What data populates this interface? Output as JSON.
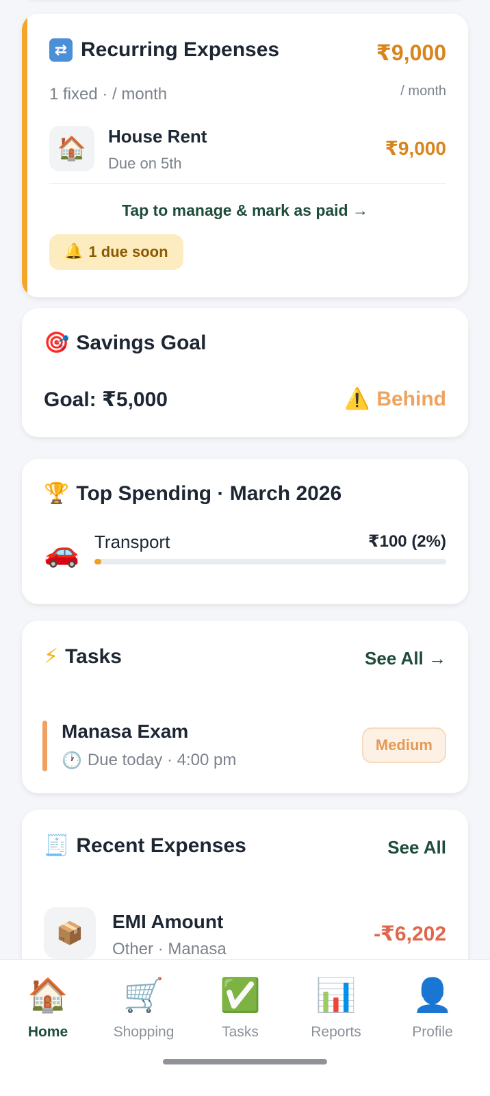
{
  "recurring": {
    "icon": "repeat-arrows-icon",
    "title": "Recurring Expenses",
    "subtitle": "1 fixed · / month",
    "total": "₹9,000",
    "per": "/ month",
    "item": {
      "icon": "house-icon",
      "name": "House Rent",
      "due": "Due on 5th",
      "amount": "₹9,000"
    },
    "manage_link": "Tap to manage & mark as paid →",
    "due_badge": "1 due soon"
  },
  "savings": {
    "title": "Savings Goal",
    "goal": "Goal: ₹5,000",
    "status": "Behind"
  },
  "top_spending": {
    "title": "Top Spending · March 2026",
    "category": {
      "icon": "car-icon",
      "name": "Transport",
      "value": "₹100 (2%)",
      "percent": 2
    }
  },
  "tasks": {
    "title": "Tasks",
    "see_all": "See All →",
    "item": {
      "name": "Manasa Exam",
      "due": "Due today · 4:00 pm",
      "priority": "Medium"
    }
  },
  "recent_expenses": {
    "title": "Recent Expenses",
    "see_all": "See All",
    "item": {
      "icon": "package-icon",
      "name": "EMI Amount",
      "meta": "Other · Manasa",
      "amount": "-₹6,202"
    }
  },
  "nav": {
    "home": "Home",
    "shopping": "Shopping",
    "tasks": "Tasks",
    "reports": "Reports",
    "profile": "Profile"
  },
  "colors": {
    "accent_orange": "#f4a62a",
    "amount_orange": "#d9841c",
    "brand_green": "#1f4d3a",
    "negative_red": "#e0674c"
  }
}
